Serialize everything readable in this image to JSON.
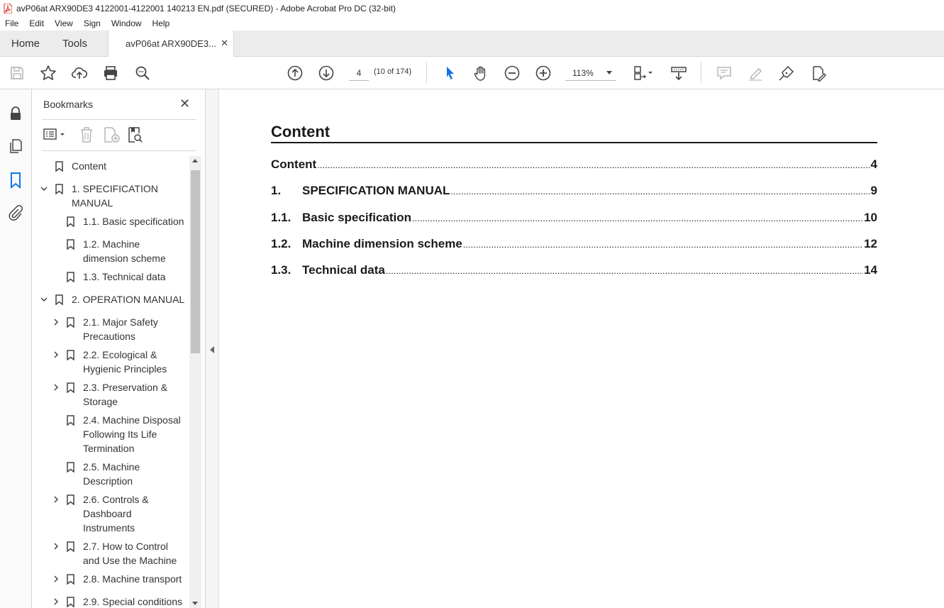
{
  "window": {
    "title": "avP06at ARX90DE3 4122001-4122001 140213 EN.pdf (SECURED) - Adobe Acrobat Pro DC (32-bit)"
  },
  "menu": [
    "File",
    "Edit",
    "View",
    "Sign",
    "Window",
    "Help"
  ],
  "tabs": {
    "home": "Home",
    "tools": "Tools",
    "document": "avP06at ARX90DE3..."
  },
  "toolbar": {
    "page_number": "4",
    "page_count": "(10 of 174)",
    "zoom": "113%"
  },
  "bookmarks": {
    "title": "Bookmarks",
    "items": [
      {
        "label": "Content",
        "level": 0,
        "expander": "none"
      },
      {
        "label": "1. SPECIFICATION MANUAL",
        "level": 0,
        "expander": "expanded"
      },
      {
        "label": "1.1. Basic specification",
        "level": 1,
        "expander": "none"
      },
      {
        "label": "1.2. Machine dimension scheme",
        "level": 1,
        "expander": "none"
      },
      {
        "label": "1.3. Technical data",
        "level": 1,
        "expander": "none"
      },
      {
        "label": "2. OPERATION MANUAL",
        "level": 0,
        "expander": "expanded"
      },
      {
        "label": "2.1. Major Safety Precautions",
        "level": 1,
        "expander": "collapsed"
      },
      {
        "label": "2.2. Ecological & Hygienic Principles",
        "level": 1,
        "expander": "collapsed"
      },
      {
        "label": "2.3. Preservation & Storage",
        "level": 1,
        "expander": "collapsed"
      },
      {
        "label": "2.4. Machine Disposal Following Its Life Termination",
        "level": 1,
        "expander": "none"
      },
      {
        "label": "2.5. Machine Description",
        "level": 1,
        "expander": "none"
      },
      {
        "label": "2.6. Controls & Dashboard Instruments",
        "level": 1,
        "expander": "collapsed"
      },
      {
        "label": "2.7. How to Control and Use the Machine",
        "level": 1,
        "expander": "collapsed"
      },
      {
        "label": "2.8. Machine transport",
        "level": 1,
        "expander": "collapsed"
      },
      {
        "label": "2.9. Special conditions",
        "level": 1,
        "expander": "collapsed"
      }
    ]
  },
  "document": {
    "heading": "Content",
    "toc": [
      {
        "number": "",
        "title": "Content",
        "page": "4"
      },
      {
        "number": "1.",
        "title": "SPECIFICATION MANUAL",
        "page": "9"
      },
      {
        "number": "1.1.",
        "title": "Basic specification",
        "page": "10"
      },
      {
        "number": "1.2.",
        "title": "Machine dimension scheme",
        "page": "12"
      },
      {
        "number": "1.3.",
        "title": "Technical data",
        "page": "14"
      }
    ]
  },
  "colors": {
    "accent": "#1473e6",
    "tab_bg": "#ececec",
    "pdf_icon": "#d4281f"
  }
}
